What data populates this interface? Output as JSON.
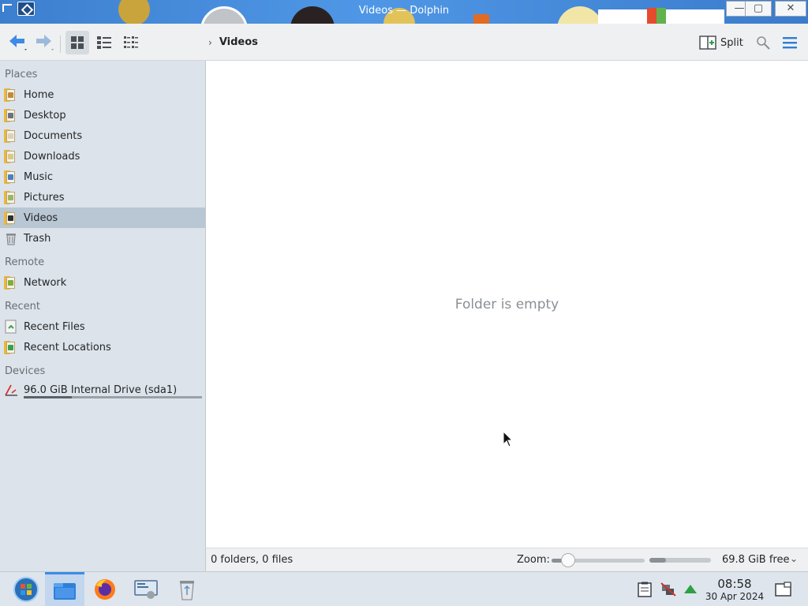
{
  "window": {
    "title": "Videos — Dolphin",
    "minimize_glyph": "—",
    "maximize_glyph": "▢",
    "close_glyph": "✕"
  },
  "toolbar": {
    "back_icon": "back-arrow-icon",
    "forward_icon": "forward-arrow-icon",
    "view_modes": [
      "icons",
      "details",
      "compact"
    ],
    "active_view_mode": "icons",
    "split_label": "Split",
    "search_icon": "search-icon",
    "menu_icon": "hamburger-menu-icon"
  },
  "breadcrumb": {
    "separator": "›",
    "current": "Videos"
  },
  "sidebar": {
    "sections": {
      "places": "Places",
      "remote": "Remote",
      "recent": "Recent",
      "devices": "Devices"
    },
    "places": [
      {
        "label": "Home",
        "icon": "home-folder-icon",
        "selected": false
      },
      {
        "label": "Desktop",
        "icon": "desktop-folder-icon",
        "selected": false
      },
      {
        "label": "Documents",
        "icon": "documents-folder-icon",
        "selected": false
      },
      {
        "label": "Downloads",
        "icon": "downloads-folder-icon",
        "selected": false
      },
      {
        "label": "Music",
        "icon": "music-folder-icon",
        "selected": false
      },
      {
        "label": "Pictures",
        "icon": "pictures-folder-icon",
        "selected": false
      },
      {
        "label": "Videos",
        "icon": "videos-folder-icon",
        "selected": true
      },
      {
        "label": "Trash",
        "icon": "trash-icon",
        "selected": false
      }
    ],
    "remote": [
      {
        "label": "Network",
        "icon": "network-folder-icon"
      }
    ],
    "recent": [
      {
        "label": "Recent Files",
        "icon": "recent-files-icon"
      },
      {
        "label": "Recent Locations",
        "icon": "recent-locations-icon"
      }
    ],
    "devices": [
      {
        "label": "96.0 GiB Internal Drive (sda1)",
        "icon": "hard-drive-icon",
        "usage_fraction": 0.27
      }
    ]
  },
  "main": {
    "empty_message": "Folder is empty"
  },
  "statusbar": {
    "summary": "0 folders, 0 files",
    "zoom_label": "Zoom:",
    "zoom_fraction": 0.18,
    "free_space": "69.8 GiB free",
    "free_space_used_fraction": 0.27,
    "chevron": "⌄"
  },
  "taskbar": {
    "apps": [
      {
        "name": "Start",
        "icon": "start-menu-icon"
      },
      {
        "name": "Dolphin",
        "icon": "dolphin-file-manager-icon",
        "active": true
      },
      {
        "name": "Firefox",
        "icon": "firefox-icon"
      },
      {
        "name": "System Settings",
        "icon": "system-settings-icon"
      },
      {
        "name": "Trash",
        "icon": "trash-bin-icon"
      }
    ],
    "tray": {
      "clock_time": "08:58",
      "clock_date": "30 Apr 2024"
    }
  },
  "colors": {
    "accent": "#3d8be6",
    "sidebar_bg": "#dde3ea",
    "selection_bg": "#b9c6d3",
    "titlebar_bg": "#4f97e6"
  }
}
